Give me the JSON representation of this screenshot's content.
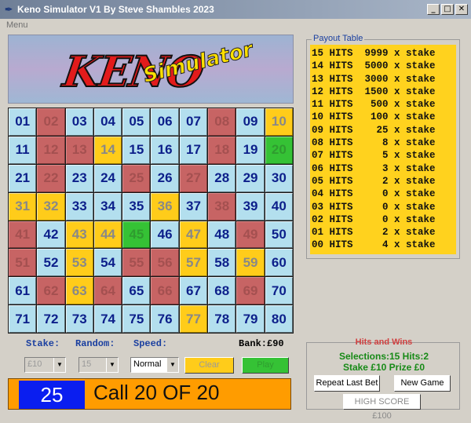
{
  "window": {
    "title": "Keno Simulator V1 By Steve Shambles 2023"
  },
  "menu": {
    "label": "Menu"
  },
  "logo": {
    "main": "KENO",
    "sub": "Simulator"
  },
  "colors": {
    "normal": "#b3dfee",
    "drawn": "#c76464",
    "selected": "#ffcc1a",
    "hit": "#35c235"
  },
  "board": {
    "cells": [
      {
        "n": "01",
        "s": "n"
      },
      {
        "n": "02",
        "s": "r"
      },
      {
        "n": "03",
        "s": "n"
      },
      {
        "n": "04",
        "s": "n"
      },
      {
        "n": "05",
        "s": "n"
      },
      {
        "n": "06",
        "s": "n"
      },
      {
        "n": "07",
        "s": "n"
      },
      {
        "n": "08",
        "s": "r"
      },
      {
        "n": "09",
        "s": "n"
      },
      {
        "n": "10",
        "s": "y"
      },
      {
        "n": "11",
        "s": "n"
      },
      {
        "n": "12",
        "s": "r"
      },
      {
        "n": "13",
        "s": "r"
      },
      {
        "n": "14",
        "s": "y"
      },
      {
        "n": "15",
        "s": "n"
      },
      {
        "n": "16",
        "s": "n"
      },
      {
        "n": "17",
        "s": "n"
      },
      {
        "n": "18",
        "s": "r"
      },
      {
        "n": "19",
        "s": "n"
      },
      {
        "n": "20",
        "s": "g"
      },
      {
        "n": "21",
        "s": "n"
      },
      {
        "n": "22",
        "s": "r"
      },
      {
        "n": "23",
        "s": "n"
      },
      {
        "n": "24",
        "s": "n"
      },
      {
        "n": "25",
        "s": "r"
      },
      {
        "n": "26",
        "s": "n"
      },
      {
        "n": "27",
        "s": "r"
      },
      {
        "n": "28",
        "s": "n"
      },
      {
        "n": "29",
        "s": "n"
      },
      {
        "n": "30",
        "s": "n"
      },
      {
        "n": "31",
        "s": "y"
      },
      {
        "n": "32",
        "s": "y"
      },
      {
        "n": "33",
        "s": "n"
      },
      {
        "n": "34",
        "s": "n"
      },
      {
        "n": "35",
        "s": "n"
      },
      {
        "n": "36",
        "s": "y"
      },
      {
        "n": "37",
        "s": "n"
      },
      {
        "n": "38",
        "s": "r"
      },
      {
        "n": "39",
        "s": "n"
      },
      {
        "n": "40",
        "s": "n"
      },
      {
        "n": "41",
        "s": "r"
      },
      {
        "n": "42",
        "s": "n"
      },
      {
        "n": "43",
        "s": "y"
      },
      {
        "n": "44",
        "s": "y"
      },
      {
        "n": "45",
        "s": "g"
      },
      {
        "n": "46",
        "s": "n"
      },
      {
        "n": "47",
        "s": "y"
      },
      {
        "n": "48",
        "s": "n"
      },
      {
        "n": "49",
        "s": "r"
      },
      {
        "n": "50",
        "s": "n"
      },
      {
        "n": "51",
        "s": "r"
      },
      {
        "n": "52",
        "s": "n"
      },
      {
        "n": "53",
        "s": "y"
      },
      {
        "n": "54",
        "s": "n"
      },
      {
        "n": "55",
        "s": "r"
      },
      {
        "n": "56",
        "s": "r"
      },
      {
        "n": "57",
        "s": "y"
      },
      {
        "n": "58",
        "s": "n"
      },
      {
        "n": "59",
        "s": "y"
      },
      {
        "n": "60",
        "s": "n"
      },
      {
        "n": "61",
        "s": "n"
      },
      {
        "n": "62",
        "s": "r"
      },
      {
        "n": "63",
        "s": "y"
      },
      {
        "n": "64",
        "s": "r"
      },
      {
        "n": "65",
        "s": "n"
      },
      {
        "n": "66",
        "s": "r"
      },
      {
        "n": "67",
        "s": "n"
      },
      {
        "n": "68",
        "s": "n"
      },
      {
        "n": "69",
        "s": "r"
      },
      {
        "n": "70",
        "s": "n"
      },
      {
        "n": "71",
        "s": "n"
      },
      {
        "n": "72",
        "s": "n"
      },
      {
        "n": "73",
        "s": "n"
      },
      {
        "n": "74",
        "s": "n"
      },
      {
        "n": "75",
        "s": "n"
      },
      {
        "n": "76",
        "s": "n"
      },
      {
        "n": "77",
        "s": "y"
      },
      {
        "n": "78",
        "s": "n"
      },
      {
        "n": "79",
        "s": "n"
      },
      {
        "n": "80",
        "s": "n"
      }
    ]
  },
  "payout": {
    "legend": "Payout Table",
    "rows": [
      "15 HITS  9999 x stake",
      "14 HITS  5000 x stake",
      "13 HITS  3000 x stake",
      "12 HITS  1500 x stake",
      "11 HITS   500 x stake",
      "10 HITS   100 x stake",
      "09 HITS    25 x stake",
      "08 HITS     8 x stake",
      "07 HITS     5 x stake",
      "06 HITS     3 x stake",
      "05 HITS     2 x stake",
      "04 HITS     0 x stake",
      "03 HITS     0 x stake",
      "02 HITS     0 x stake",
      "01 HITS     2 x stake",
      "00 HITS     4 x stake"
    ]
  },
  "controls": {
    "stake_label": "Stake:",
    "random_label": "Random:",
    "speed_label": "Speed:",
    "bank": "Bank:£90",
    "stake_value": "£10",
    "random_value": "15",
    "speed_value": "Normal",
    "clear_label": "Clear",
    "play_label": "Play"
  },
  "call": {
    "number": "25",
    "text": "Call 20 OF 20"
  },
  "hits": {
    "title": "Hits and Wins",
    "line1": "Selections:15  Hits:2",
    "line2": "Stake £10   Prize £0",
    "repeat_label": "Repeat Last Bet",
    "new_label": "New  Game",
    "high_score_label": "HIGH SCORE £100"
  }
}
